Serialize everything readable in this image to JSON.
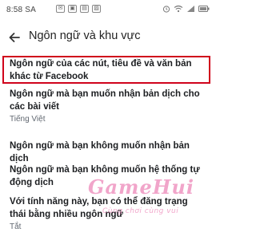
{
  "status_bar": {
    "time": "8:58 SA",
    "left_icons": [
      "messenger-icon",
      "image-icon",
      "gallery-icon",
      "photo-icon"
    ],
    "right_icons": [
      "alarm-icon",
      "wifi-icon",
      "signal-icon",
      "battery-icon"
    ]
  },
  "header": {
    "title": "Ngôn ngữ và khu vực"
  },
  "items": [
    {
      "title": "Ngôn ngữ của các nút, tiêu đề và văn bản khác từ Facebook",
      "subtitle": ""
    },
    {
      "title": "Ngôn ngữ mà bạn muốn nhận bản dịch cho các bài viết",
      "subtitle": "Tiếng Việt"
    },
    {
      "title": "Ngôn ngữ mà bạn không muốn nhận bản dịch",
      "subtitle": ""
    },
    {
      "title": "Ngôn ngữ mà bạn không muốn hệ thống tự động dịch",
      "subtitle": ""
    },
    {
      "title": "Với tính năng này, bạn có thể đăng trạng thái bằng nhiều ngôn ngữ",
      "subtitle": "Tắt"
    }
  ],
  "watermark": {
    "logo_text": "GameHui",
    "tagline": "Cùng chơi cùng vui"
  },
  "colors": {
    "highlight": "#d0021b",
    "watermark": "#e65d9f"
  }
}
